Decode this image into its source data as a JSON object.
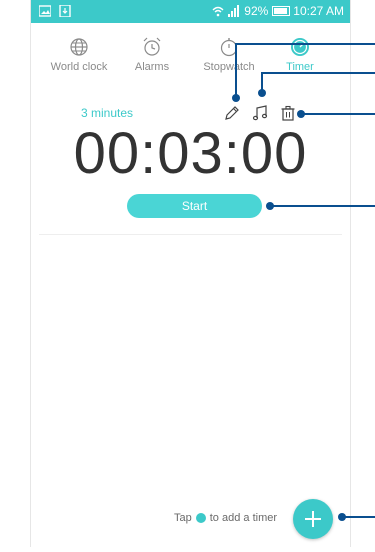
{
  "statusbar": {
    "battery": "92%",
    "time": "10:27 AM",
    "battery_level": 0.92
  },
  "tabs": [
    {
      "label": "World clock",
      "icon": "globe-icon",
      "active": false
    },
    {
      "label": "Alarms",
      "icon": "alarm-clock-icon",
      "active": false
    },
    {
      "label": "Stopwatch",
      "icon": "stopwatch-icon",
      "active": false
    },
    {
      "label": "Timer",
      "icon": "timer-icon",
      "active": true
    }
  ],
  "timer": {
    "name": "3 minutes",
    "display": "00:03:00",
    "start_label": "Start",
    "tools": [
      "pencil-icon",
      "music-note-icon",
      "trash-icon"
    ]
  },
  "footer": {
    "hint_before": "Tap",
    "hint_after": "to add a timer"
  },
  "colors": {
    "accent": "#3cc9c9",
    "button": "#4ad5d5",
    "text_dark": "#333333",
    "text_muted": "#8a8a8a",
    "callout": "#0a4f8f"
  }
}
